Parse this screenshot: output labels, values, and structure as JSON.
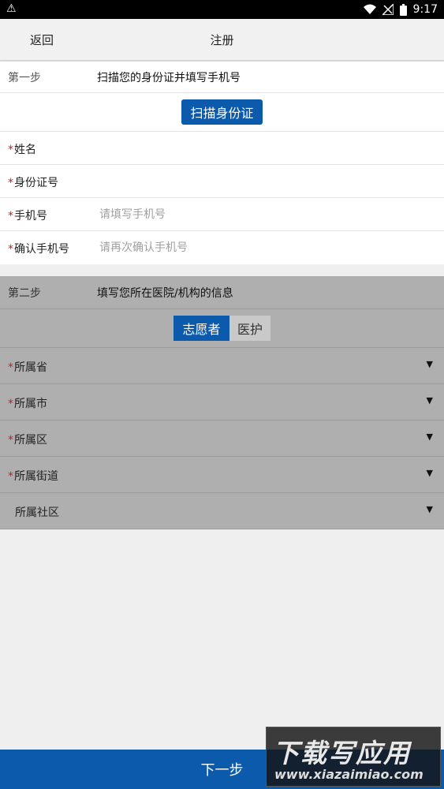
{
  "status_bar": {
    "time": "9:17"
  },
  "nav": {
    "back_label": "返回",
    "title": "注册"
  },
  "step1": {
    "label": "第一步",
    "desc": "扫描您的身份证并填写手机号",
    "scan_button": "扫描身份证",
    "fields": [
      {
        "label": "姓名",
        "required": "*",
        "placeholder": ""
      },
      {
        "label": "身份证号",
        "required": "*",
        "placeholder": ""
      },
      {
        "label": "手机号",
        "required": "*",
        "placeholder": "请填写手机号"
      },
      {
        "label": "确认手机号",
        "required": "*",
        "placeholder": "请再次确认手机号"
      }
    ]
  },
  "step2": {
    "label": "第二步",
    "desc": "填写您所在医院/机构的信息",
    "toggle": {
      "options": [
        "志愿者",
        "医护"
      ],
      "selected": "志愿者"
    },
    "selects": [
      {
        "label": "所属省",
        "required": "*"
      },
      {
        "label": "所属市",
        "required": "*"
      },
      {
        "label": "所属区",
        "required": "*"
      },
      {
        "label": "所属街道",
        "required": "*"
      },
      {
        "label": "所属社区",
        "required": ""
      }
    ],
    "dropdown_arrow": "▼"
  },
  "footer": {
    "next_label": "下一步"
  },
  "watermark": {
    "big": "下载写应用",
    "small": "www.xiazaimiao.com"
  },
  "colors": {
    "primary": "#0c5aab",
    "required": "#c81e1e",
    "dim_overlay": "#afafaf"
  },
  "icons": [
    "warning-icon",
    "wifi-icon",
    "no-signal-icon",
    "battery-icon",
    "dropdown-arrow-icon"
  ]
}
